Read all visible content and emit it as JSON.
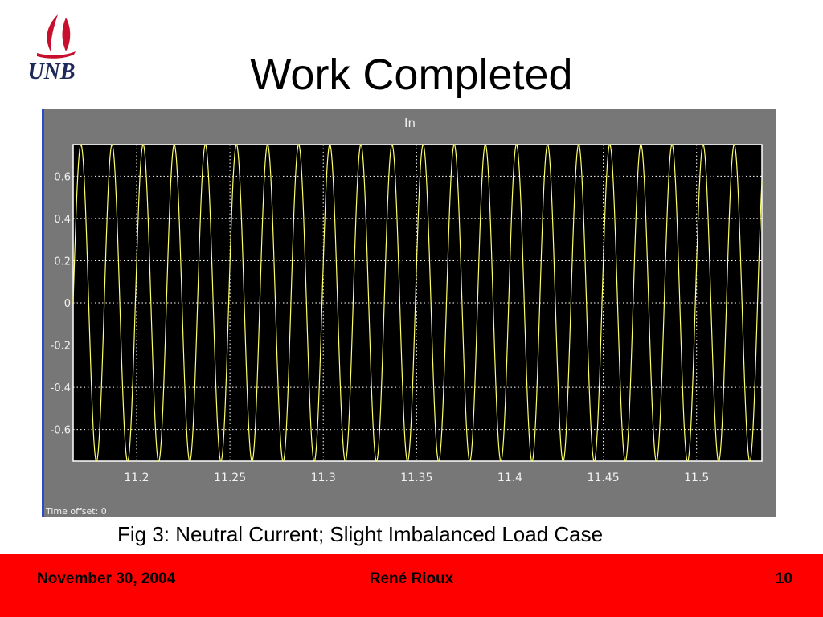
{
  "slide": {
    "title": "Work Completed",
    "caption": "Fig 3: Neutral Current; Slight Imbalanced Load Case",
    "logo_text": "UNB",
    "logo_color": "#c8102e"
  },
  "footer": {
    "date": "November 30, 2004",
    "author": "René Rioux",
    "page": "10",
    "background": "#ff0000"
  },
  "chart_data": {
    "type": "line",
    "title": "In",
    "xlabel": "",
    "ylabel": "",
    "time_offset_label": "Time offset: 0",
    "xlim": [
      11.166,
      11.535
    ],
    "ylim": [
      -0.75,
      0.75
    ],
    "x_ticks": [
      11.2,
      11.25,
      11.3,
      11.35,
      11.4,
      11.45,
      11.5
    ],
    "x_tick_labels": [
      "11.2",
      "11.25",
      "11.3",
      "11.35",
      "11.4",
      "11.45",
      "11.5"
    ],
    "y_ticks": [
      0.6,
      0.4,
      0.2,
      0,
      -0.2,
      -0.4,
      -0.6
    ],
    "y_tick_labels": [
      "0.6",
      "0.4",
      "0.2",
      "0",
      "-0.2",
      "-0.4",
      "-0.6"
    ],
    "grid": true,
    "background_color": "#000000",
    "frame_color": "#777777",
    "series": [
      {
        "amplitude": 0.75,
        "frequency_hz": 60,
        "start_time": 11.166,
        "end_time": 11.535,
        "color": "#ffff66"
      }
    ]
  }
}
